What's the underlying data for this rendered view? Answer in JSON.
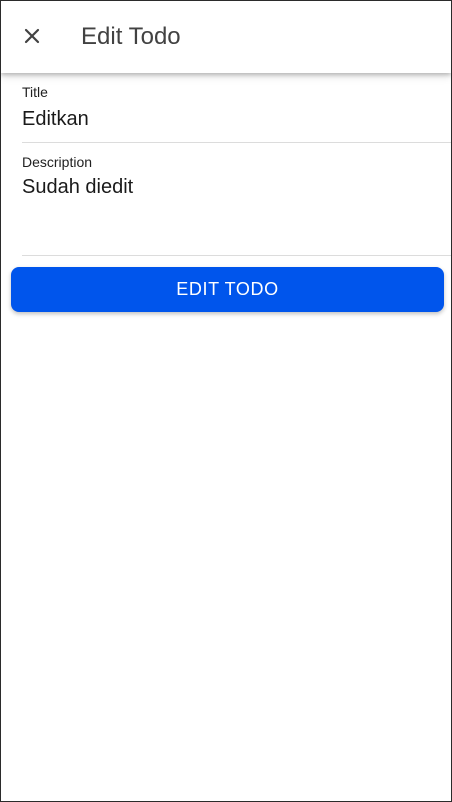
{
  "app_bar": {
    "close_icon": "close-icon",
    "title": "Edit Todo"
  },
  "form": {
    "title_label": "Title",
    "title_value": "Editkan",
    "description_label": "Description",
    "description_value": "Sudah diedit"
  },
  "submit": {
    "label": "EDIT TODO"
  },
  "colors": {
    "accent": "#0055ec",
    "app_bar_bg": "#ffffff",
    "divider": "#dcdcdc"
  }
}
